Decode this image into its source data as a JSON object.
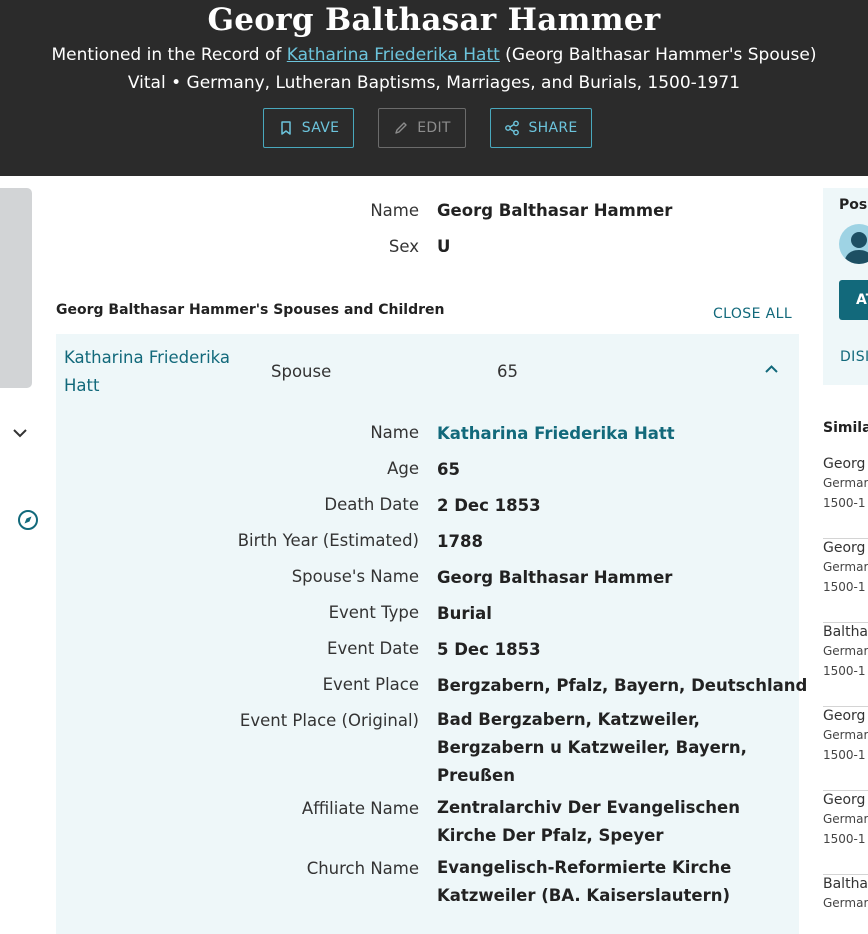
{
  "header": {
    "title": "Georg Balthasar Hammer",
    "mention_prefix": "Mentioned in the Record of ",
    "mention_link": "Katharina Friederika Hatt",
    "mention_suffix": " (Georg Balthasar Hammer's Spouse)",
    "collection": "Vital • Germany, Lutheran Baptisms, Marriages, and Burials, 1500-1971",
    "save_label": "SAVE",
    "edit_label": "EDIT",
    "share_label": "SHARE"
  },
  "person": {
    "name_label": "Name",
    "name_value": "Georg Balthasar Hammer",
    "sex_label": "Sex",
    "sex_value": "U"
  },
  "family": {
    "section_title": "Georg Balthasar Hammer's Spouses and Children",
    "close_all": "CLOSE ALL",
    "spouse": {
      "name": "Katharina Friederika Hatt",
      "role": "Spouse",
      "age": "65"
    },
    "details": [
      {
        "label": "Name",
        "value": "Katharina Friederika Hatt"
      },
      {
        "label": "Age",
        "value": "65"
      },
      {
        "label": "Death Date",
        "value": "2 Dec 1853"
      },
      {
        "label": "Birth Year (Estimated)",
        "value": "1788"
      },
      {
        "label": "Spouse's Name",
        "value": "Georg Balthasar Hammer"
      },
      {
        "label": "Event Type",
        "value": "Burial"
      },
      {
        "label": "Event Date",
        "value": "5 Dec 1853"
      },
      {
        "label": "Event Place",
        "value": "Bergzabern, Pfalz, Bayern, Deutschland"
      },
      {
        "label": "Event Place (Original)",
        "value": "Bad Bergzabern, Katzweiler, Bergzabern u Katzweiler, Bayern, Preußen"
      },
      {
        "label": "Affiliate Name",
        "value": "Zentralarchiv Der Evangelischen Kirche Der Pfalz, Speyer"
      },
      {
        "label": "Church Name",
        "value": "Evangelisch-Reformierte Kirche Katzweiler (BA. Kaiserslautern)"
      }
    ]
  },
  "sidebar": {
    "card_title": "Pos",
    "button_label": "AT",
    "dismiss_label": "DISI",
    "similar_title": "Simila",
    "similar_items": [
      {
        "name": "Georg",
        "line1": "Germar",
        "line2": "1500-1"
      },
      {
        "name": "Georg",
        "line1": "Germar",
        "line2": "1500-1"
      },
      {
        "name": "Baltha",
        "line1": "Germar",
        "line2": "1500-1"
      },
      {
        "name": "Georg",
        "line1": "Germar",
        "line2": "1500-1"
      },
      {
        "name": "Georg",
        "line1": "Germar",
        "line2": "1500-1"
      },
      {
        "name": "Baltha",
        "line1": "Germar",
        "line2": ""
      }
    ]
  },
  "colors": {
    "header_bg": "#2b2b2b",
    "accent": "#12697b",
    "accent_light": "#6cc4dc",
    "panel_bg": "#eef7f9"
  }
}
